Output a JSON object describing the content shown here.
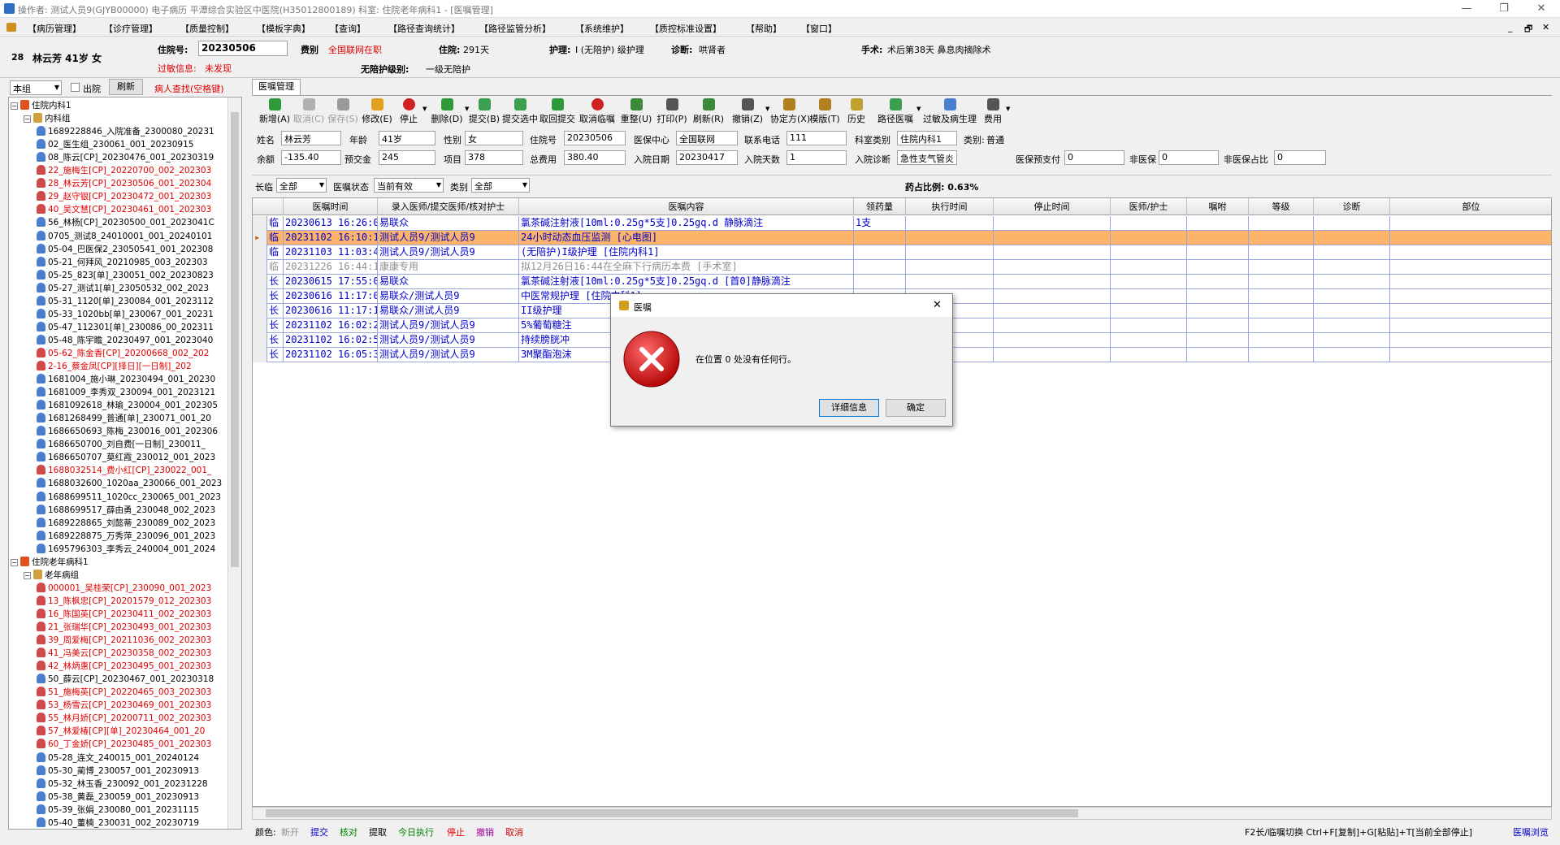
{
  "window": {
    "title": "操作者: 测试人员9(GJYB00000) 电子病历  平潭综合实验区中医院(H35012800189)  科室: 住院老年病科1 - [医嘱管理]",
    "minimize": "—",
    "restore": "❐",
    "close": "✕"
  },
  "menu": [
    "【病历管理】",
    "【诊疗管理】",
    "【质量控制】",
    "【模板字典】",
    "【查询】",
    "【路径查询统计】",
    "【路径监管分析】",
    "【系统维护】",
    "【质控标准设置】",
    "【帮助】",
    "【窗口】"
  ],
  "menu_right": {
    "minimize": "_",
    "restore": "🗗",
    "close": "✕"
  },
  "patient": {
    "bed": "28",
    "name_age": "林云芳 41岁 女",
    "admission_label": "住院号:",
    "admission_no": "20230506",
    "type_label": "费别",
    "type_value": "全国联网在职",
    "hosp_label": "住院:",
    "hosp_days": "291天",
    "nursing_label": "护理:",
    "nursing_value": "I (无陪护) 级护理",
    "diag_label": "诊断:",
    "diag_value": "哄肾者",
    "surgery_label": "手术:",
    "surgery_value": "术后第38天 鼻息肉摘除术",
    "allergy_label": "过敏信息:",
    "allergy_value": "未发现",
    "escort_label": "无陪护级别:",
    "escort_value": "一级无陪护"
  },
  "left": {
    "scope": "本组",
    "discharge": "出院",
    "refresh": "刷新",
    "search_hint": "病人查找(空格键)"
  },
  "tree": [
    {
      "level": 0,
      "type": "dept",
      "text": "住院内科1",
      "color": "#000"
    },
    {
      "level": 1,
      "type": "group",
      "text": "内科组",
      "color": "#000"
    },
    {
      "level": 2,
      "type": "p",
      "text": "1689228846_入院准备_2300080_20231",
      "color": "#000",
      "ico": "#4a7fd0"
    },
    {
      "level": 2,
      "type": "p",
      "text": "02_医生组_230061_001_20230915",
      "color": "#000",
      "ico": "#4a7fd0"
    },
    {
      "level": 2,
      "type": "p",
      "text": "08_陈云[CP]_20230476_001_20230319",
      "color": "#000",
      "ico": "#4a7fd0"
    },
    {
      "level": 2,
      "type": "p",
      "text": "22_施梅生[CP]_20220700_002_202303",
      "color": "#e00000",
      "ico": "#d04a4a"
    },
    {
      "level": 2,
      "type": "p",
      "text": "28_林云芳[CP]_20230506_001_202304",
      "color": "#e00000",
      "ico": "#d04a4a"
    },
    {
      "level": 2,
      "type": "p",
      "text": "29_赵守银[CP]_20230472_001_202303",
      "color": "#e00000",
      "ico": "#d04a4a"
    },
    {
      "level": 2,
      "type": "p",
      "text": "40_吴文慧[CP]_20230461_001_202303",
      "color": "#e00000",
      "ico": "#d04a4a"
    },
    {
      "level": 2,
      "type": "p",
      "text": "56_林杨[CP]_20230500_001_2023041C",
      "color": "#000",
      "ico": "#4a7fd0"
    },
    {
      "level": 2,
      "type": "p",
      "text": "0705_测试8_24010001_001_20240101",
      "color": "#000",
      "ico": "#4a7fd0"
    },
    {
      "level": 2,
      "type": "p",
      "text": "05-04_巴医保2_23050541_001_202308",
      "color": "#000",
      "ico": "#4a7fd0"
    },
    {
      "level": 2,
      "type": "p",
      "text": "05-21_何拜风_20210985_003_202303",
      "color": "#000",
      "ico": "#4a7fd0"
    },
    {
      "level": 2,
      "type": "p",
      "text": "05-25_823[单]_230051_002_20230823",
      "color": "#000",
      "ico": "#4a7fd0"
    },
    {
      "level": 2,
      "type": "p",
      "text": "05-27_测试1[单]_23050532_002_2023",
      "color": "#000",
      "ico": "#4a7fd0"
    },
    {
      "level": 2,
      "type": "p",
      "text": "05-31_1120[单]_230084_001_2023112",
      "color": "#000",
      "ico": "#4a7fd0"
    },
    {
      "level": 2,
      "type": "p",
      "text": "05-33_1020bb[单]_230067_001_20231",
      "color": "#000",
      "ico": "#4a7fd0"
    },
    {
      "level": 2,
      "type": "p",
      "text": "05-47_112301[单]_230086_00_202311",
      "color": "#000",
      "ico": "#4a7fd0"
    },
    {
      "level": 2,
      "type": "p",
      "text": "05-48_陈宇瞻_20230497_001_2023040",
      "color": "#000",
      "ico": "#4a7fd0"
    },
    {
      "level": 2,
      "type": "p",
      "text": "05-62_陈金香[CP]_20200668_002_202",
      "color": "#e00000",
      "ico": "#d04a4a"
    },
    {
      "level": 2,
      "type": "p",
      "text": "2-16_蔡金凤[CP][择日][一日制]_202",
      "color": "#e00000",
      "ico": "#d04a4a"
    },
    {
      "level": 2,
      "type": "p",
      "text": "1681004_施小琳_20230494_001_20230",
      "color": "#000",
      "ico": "#4a7fd0"
    },
    {
      "level": 2,
      "type": "p",
      "text": "1681009_李秀双_230094_001_2023121",
      "color": "#000",
      "ico": "#4a7fd0"
    },
    {
      "level": 2,
      "type": "p",
      "text": "1681092618_林瑜_230004_001_202305",
      "color": "#000",
      "ico": "#4a7fd0"
    },
    {
      "level": 2,
      "type": "p",
      "text": "1681268499_普通[单]_230071_001_20",
      "color": "#000",
      "ico": "#4a7fd0"
    },
    {
      "level": 2,
      "type": "p",
      "text": "1686650693_陈梅_230016_001_202306",
      "color": "#000",
      "ico": "#4a7fd0"
    },
    {
      "level": 2,
      "type": "p",
      "text": "1686650700_刘自费[一日制]_230011_",
      "color": "#000",
      "ico": "#4a7fd0"
    },
    {
      "level": 2,
      "type": "p",
      "text": "1686650707_莫红霞_230012_001_2023",
      "color": "#000",
      "ico": "#4a7fd0"
    },
    {
      "level": 2,
      "type": "p",
      "text": "1688032514_费小红[CP]_230022_001_",
      "color": "#e00000",
      "ico": "#d04a4a"
    },
    {
      "level": 2,
      "type": "p",
      "text": "1688032600_1020aa_230066_001_2023",
      "color": "#000",
      "ico": "#4a7fd0"
    },
    {
      "level": 2,
      "type": "p",
      "text": "1688699511_1020cc_230065_001_2023",
      "color": "#000",
      "ico": "#4a7fd0"
    },
    {
      "level": 2,
      "type": "p",
      "text": "1688699517_薛由勇_230048_002_2023",
      "color": "#000",
      "ico": "#4a7fd0"
    },
    {
      "level": 2,
      "type": "p",
      "text": "1689228865_刘懿蒂_230089_002_2023",
      "color": "#000",
      "ico": "#4a7fd0"
    },
    {
      "level": 2,
      "type": "p",
      "text": "1689228875_万秀萍_230096_001_2023",
      "color": "#000",
      "ico": "#4a7fd0"
    },
    {
      "level": 2,
      "type": "p",
      "text": "1695796303_李秀云_240004_001_2024",
      "color": "#000",
      "ico": "#4a7fd0"
    },
    {
      "level": 0,
      "type": "dept",
      "text": "住院老年病科1",
      "color": "#000"
    },
    {
      "level": 1,
      "type": "group",
      "text": "老年病组",
      "color": "#000"
    },
    {
      "level": 2,
      "type": "p",
      "text": "000001_吴桂荣[CP]_230090_001_2023",
      "color": "#e00000",
      "ico": "#d04a4a"
    },
    {
      "level": 2,
      "type": "p",
      "text": "13_陈枫忠[CP]_20201579_012_202303",
      "color": "#e00000",
      "ico": "#d04a4a"
    },
    {
      "level": 2,
      "type": "p",
      "text": "16_陈国英[CP]_20230411_002_202303",
      "color": "#e00000",
      "ico": "#d04a4a"
    },
    {
      "level": 2,
      "type": "p",
      "text": "21_张瑞华[CP]_20230493_001_202303",
      "color": "#e00000",
      "ico": "#d04a4a"
    },
    {
      "level": 2,
      "type": "p",
      "text": "39_周爱梅[CP]_20211036_002_202303",
      "color": "#e00000",
      "ico": "#d04a4a"
    },
    {
      "level": 2,
      "type": "p",
      "text": "41_冯美云[CP]_20230358_002_202303",
      "color": "#e00000",
      "ico": "#d04a4a"
    },
    {
      "level": 2,
      "type": "p",
      "text": "42_林炳惠[CP]_20230495_001_202303",
      "color": "#e00000",
      "ico": "#d04a4a"
    },
    {
      "level": 2,
      "type": "p",
      "text": "50_薛云[CP]_20230467_001_20230318",
      "color": "#000",
      "ico": "#4a7fd0"
    },
    {
      "level": 2,
      "type": "p",
      "text": "51_施梅英[CP]_20220465_003_202303",
      "color": "#e00000",
      "ico": "#d04a4a"
    },
    {
      "level": 2,
      "type": "p",
      "text": "53_杨雪云[CP]_20230469_001_202303",
      "color": "#e00000",
      "ico": "#d04a4a"
    },
    {
      "level": 2,
      "type": "p",
      "text": "55_林月娇[CP]_20200711_002_202303",
      "color": "#e00000",
      "ico": "#d04a4a"
    },
    {
      "level": 2,
      "type": "p",
      "text": "57_林爱椿[CP][单]_20230464_001_20",
      "color": "#e00000",
      "ico": "#d04a4a"
    },
    {
      "level": 2,
      "type": "p",
      "text": "60_丁金娇[CP]_20230485_001_202303",
      "color": "#e00000",
      "ico": "#d04a4a"
    },
    {
      "level": 2,
      "type": "p",
      "text": "05-28_连文_240015_001_20240124",
      "color": "#000",
      "ico": "#4a7fd0"
    },
    {
      "level": 2,
      "type": "p",
      "text": "05-30_蔺博_230057_001_20230913",
      "color": "#000",
      "ico": "#4a7fd0"
    },
    {
      "level": 2,
      "type": "p",
      "text": "05-32_林玉香_230092_001_20231228",
      "color": "#000",
      "ico": "#4a7fd0"
    },
    {
      "level": 2,
      "type": "p",
      "text": "05-38_黄磊_230059_001_20230913",
      "color": "#000",
      "ico": "#4a7fd0"
    },
    {
      "level": 2,
      "type": "p",
      "text": "05-39_张娟_230080_001_20231115",
      "color": "#000",
      "ico": "#4a7fd0"
    },
    {
      "level": 2,
      "type": "p",
      "text": "05-40_董楠_230031_002_20230719",
      "color": "#000",
      "ico": "#4a7fd0"
    }
  ],
  "tab": "医嘱管理",
  "toolbar": [
    {
      "label": "新增(A)",
      "color": "#2e9b3a",
      "dd": false
    },
    {
      "label": "取消(C)",
      "color": "#b0b0b0",
      "dd": false,
      "disabled": true
    },
    {
      "label": "保存(S)",
      "color": "#9a9a9a",
      "dd": false,
      "disabled": true
    },
    {
      "label": "修改(E)",
      "color": "#e0a020",
      "dd": false
    },
    {
      "label": "停止",
      "color": "#d02020",
      "dd": true
    },
    {
      "label": "删除(D)",
      "color": "#2e9b3a",
      "dd": true
    },
    {
      "label": "提交(B)",
      "color": "#3aa050",
      "dd": false
    },
    {
      "label": "提交选中",
      "color": "#3aa050",
      "dd": false
    },
    {
      "label": "取回提交",
      "color": "#2e9b3a",
      "dd": false
    },
    {
      "label": "取消临嘱",
      "color": "#d02020",
      "dd": false
    },
    {
      "label": "重整(U)",
      "color": "#3a8a3a",
      "dd": false
    },
    {
      "label": "打印(P)",
      "color": "#555555",
      "dd": false
    },
    {
      "label": "刷新(R)",
      "color": "#3a8a3a",
      "dd": false
    },
    {
      "label": "撤销(Z)",
      "color": "#555555",
      "dd": true
    },
    {
      "label": "协定方(X)",
      "color": "#b08020",
      "dd": false
    },
    {
      "label": "模版(T)",
      "color": "#b08020",
      "dd": false
    },
    {
      "label": "历史",
      "color": "#c0a030",
      "dd": false
    },
    {
      "label": "路径医嘱",
      "color": "#3aa050",
      "dd": true
    },
    {
      "label": "过敏及病生理",
      "color": "#4a7fd0",
      "dd": false
    },
    {
      "label": "费用",
      "color": "#555555",
      "dd": true
    }
  ],
  "info": {
    "name_l": "姓名",
    "name": "林云芳",
    "age_l": "年龄",
    "age": "41岁",
    "sex_l": "性别",
    "sex": "女",
    "adm_l": "住院号",
    "adm": "20230506",
    "center_l": "医保中心",
    "center": "全国联网",
    "phone_l": "联系电话",
    "phone": "111",
    "dept_l": "科室类别",
    "dept": "住院内科1",
    "cat_l": "类别:",
    "cat": "普通",
    "bal_l": "余额",
    "bal": "-135.40",
    "prepay_l": "预交金",
    "prepay": "245",
    "items_l": "项目",
    "items": "378",
    "total_l": "总费用",
    "total": "380.40",
    "admdate_l": "入院日期",
    "admdate": "20230417",
    "days_l": "入院天数",
    "days": "1",
    "admdiag_l": "入院诊断",
    "admdiag": "急性支气管炎",
    "ins_l": "医保预支付",
    "ins": "0",
    "nonins_l": "非医保",
    "nonins": "0",
    "ratio_l": "非医保占比",
    "ratio": "0"
  },
  "filter": {
    "long_l": "长临",
    "long": "全部",
    "state_l": "医嘱状态",
    "state": "当前有效",
    "type_l": "类别",
    "type": "全部",
    "drug_ratio": "药占比例: 0.63%"
  },
  "grid": {
    "headers": [
      "医嘱时间",
      "录入医师/提交医师/核对护士",
      "医嘱内容",
      "领药量",
      "执行时间",
      "停止时间",
      "医师/护士",
      "嘱咐",
      "等级",
      "诊断",
      "部位"
    ],
    "rows": [
      {
        "k": "临",
        "time": "20230613 16:26:00",
        "doc": "易联众",
        "content": "氯茶碱注射液[10ml:0.25g*5支]0.25gq.d 静脉滴注",
        "qty": "1支",
        "color": "#0000cc",
        "hl": false
      },
      {
        "k": "临",
        "time": "20231102 16:10:11",
        "doc": "测试人员9/测试人员9",
        "content": "24小时动态血压监测    [心电图]",
        "qty": "",
        "color": "#0000cc",
        "hl": true
      },
      {
        "k": "临",
        "time": "20231103 11:03:45",
        "doc": "测试人员9/测试人员9",
        "content": "(无陪护)I级护理    [住院内科1]",
        "qty": "",
        "color": "#0000cc",
        "hl": false
      },
      {
        "k": "临",
        "time": "20231226 16:44:14",
        "doc": "康康专用",
        "content": "拟12月26日16:44在全麻下行病历本费    [手术室]",
        "qty": "",
        "color": "#909090",
        "hl": false
      },
      {
        "k": "长",
        "time": "20230615 17:55:01",
        "doc": "易联众",
        "content": "氯茶碱注射液[10ml:0.25g*5支]0.25gq.d [首0]静脉滴注",
        "qty": "",
        "color": "#0000cc",
        "hl": false
      },
      {
        "k": "长",
        "time": "20230616 11:17:08",
        "doc": "易联众/测试人员9",
        "content": "中医常规护理    [住院内科1]",
        "qty": "",
        "color": "#0000cc",
        "hl": false
      },
      {
        "k": "长",
        "time": "20230616 11:17:10",
        "doc": "易联众/测试人员9",
        "content": "II级护理",
        "qty": "",
        "color": "#0000cc",
        "hl": false
      },
      {
        "k": "长",
        "time": "20231102 16:02:29",
        "doc": "测试人员9/测试人员9",
        "content": "5%葡萄糖注",
        "qty": "",
        "color": "#0000cc",
        "hl": false
      },
      {
        "k": "长",
        "time": "20231102 16:02:51",
        "doc": "测试人员9/测试人员9",
        "content": "持续膀胱冲",
        "qty": "",
        "color": "#0000cc",
        "hl": false
      },
      {
        "k": "长",
        "time": "20231102 16:05:34",
        "doc": "测试人员9/测试人员9",
        "content": "3M聚酯泡沫",
        "qty": "",
        "color": "#0000cc",
        "hl": false
      }
    ]
  },
  "status": {
    "legend_l": "颜色:",
    "legend": [
      {
        "t": "新开",
        "c": "#909090"
      },
      {
        "t": "提交",
        "c": "#0000cc"
      },
      {
        "t": "核对",
        "c": "#008000"
      },
      {
        "t": "提取",
        "c": "#000000"
      },
      {
        "t": "今日执行",
        "c": "#008000"
      },
      {
        "t": "停止",
        "c": "#e00000"
      },
      {
        "t": "撤销",
        "c": "#a000a0"
      },
      {
        "t": "取消",
        "c": "#e00000"
      }
    ],
    "hint": "F2长/临嘱切换 Ctrl+F[复制]+G[粘贴]+T[当前全部停止]",
    "right": "医嘱浏览"
  },
  "dialog": {
    "title": "医嘱",
    "message": "在位置 0 处没有任何行。",
    "details": "详细信息",
    "ok": "确定",
    "close": "✕"
  }
}
